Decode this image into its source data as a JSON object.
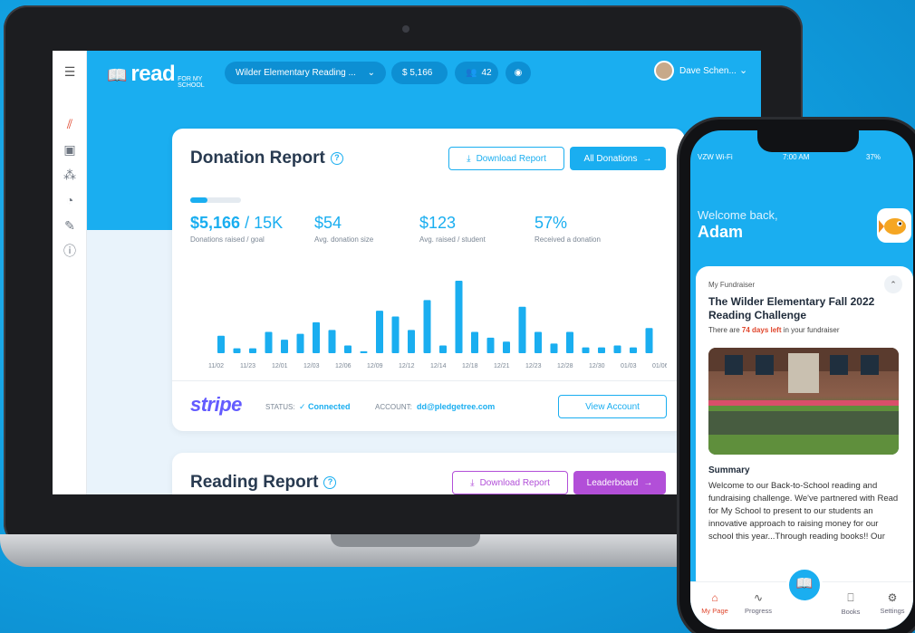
{
  "app": {
    "logo_main": "read",
    "logo_sub": "FOR MY SCHOOL",
    "campaign": "Wilder Elementary Reading ...",
    "raised_pill": "$ 5,166",
    "readers_pill": "42",
    "user": "Dave Schen...",
    "brand_color": "#1aaef0",
    "accent_purple": "#b24fd8"
  },
  "sidebar": {
    "items": [
      {
        "icon": "menu-icon"
      },
      {
        "icon": "chart-icon"
      },
      {
        "icon": "contacts-icon"
      },
      {
        "icon": "group-icon"
      },
      {
        "icon": "piggy-bank-icon"
      },
      {
        "icon": "pencil-icon"
      },
      {
        "icon": "help-icon"
      }
    ]
  },
  "donation_report": {
    "title": "Donation Report",
    "download_label": "Download Report",
    "all_label": "All Donations",
    "progress": 0.34,
    "stats": [
      {
        "value": "$5,166",
        "suffix": " / 15K",
        "label": "Donations raised / goal"
      },
      {
        "value": "$54",
        "suffix": "",
        "label": "Avg. donation size"
      },
      {
        "value": "$123",
        "suffix": "",
        "label": "Avg. raised / student"
      },
      {
        "value": "57%",
        "suffix": "",
        "label": "Received a donation"
      }
    ],
    "stripe_logo": "stripe",
    "status_label": "STATUS:",
    "status_value": "Connected",
    "account_label": "ACCOUNT:",
    "account_value": "dd@pledgetree.com",
    "view_account_label": "View Account"
  },
  "chart_data": {
    "type": "bar",
    "categories": [
      "11/02",
      "11/23",
      "12/01",
      "12/03",
      "12/06",
      "12/09",
      "12/12",
      "12/14",
      "12/18",
      "12/21",
      "12/23",
      "12/28",
      "12/30",
      "01/03",
      "01/06"
    ],
    "values": [
      18,
      5,
      5,
      22,
      14,
      20,
      32,
      24,
      8,
      2,
      44,
      38,
      24,
      55,
      8,
      75,
      22,
      16,
      12,
      48,
      22,
      10,
      22,
      6,
      6,
      8,
      6,
      26
    ],
    "xlabel": "",
    "ylabel": ""
  },
  "reading_report": {
    "title": "Reading Report",
    "download_label": "Download Report",
    "leaderboard_label": "Leaderboard"
  },
  "phone": {
    "carrier": "VZW Wi-Fi",
    "time": "7:00 AM",
    "battery": "37%",
    "welcome": "Welcome back,",
    "name": "Adam",
    "section_label": "My Fundraiser",
    "fundraiser_title": "The Wilder Elementary Fall 2022 Reading Challenge",
    "days_prefix": "There are ",
    "days_value": "74 days left",
    "days_suffix": " in your fundraiser",
    "summary_title": "Summary",
    "summary_text": "Welcome to our Back-to-School reading and fundraising challenge. We've partnered with Read for My School to present to our students an innovative approach to raising money for our school this year...Through reading books!!   Our",
    "nav": [
      "My Page",
      "Progress",
      "Books",
      "Settings"
    ]
  }
}
